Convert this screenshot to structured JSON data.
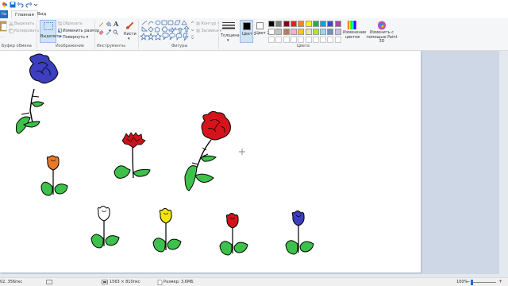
{
  "tabs": {
    "file": "File",
    "home": "Главная",
    "view": "Вид"
  },
  "clipboard": {
    "cut": "Вырезать",
    "copy": "Копировать",
    "label": "Буфер обмена"
  },
  "image": {
    "select": "Выделить",
    "crop": "Обрезать",
    "resize": "Изменить размер",
    "rotate": "Повернуть",
    "label": "Изображение"
  },
  "tools": {
    "label": "Инструменты",
    "brushes": "Кисти"
  },
  "shapes": {
    "outline": "Контур",
    "fill": "Заливка",
    "label": "Фигуры"
  },
  "size": {
    "label": "Толщина"
  },
  "colors": {
    "color1": "Цвет 1",
    "color2": "Цвет 2",
    "edit": "Изменение цветов",
    "paint3d": "Изменить с помощью Paint 3D",
    "label": "Цвета",
    "palette_row1": [
      "#000000",
      "#7f7f7f",
      "#880015",
      "#ed1c24",
      "#ff7f27",
      "#fff200",
      "#22b14c",
      "#00a2e8",
      "#3f48cc",
      "#a349a4"
    ],
    "palette_row2": [
      "#ffffff",
      "#c3c3c3",
      "#b97a57",
      "#ffaec9",
      "#ffc90e",
      "#efe4b0",
      "#b5e61d",
      "#99d9ea",
      "#7092be",
      "#c8bfe7"
    ]
  },
  "status": {
    "cursor": "02, 356пкс",
    "dimensions": "1563 × 810пкс",
    "filesize": "Размер: 3,6МБ",
    "zoom": "100%"
  }
}
